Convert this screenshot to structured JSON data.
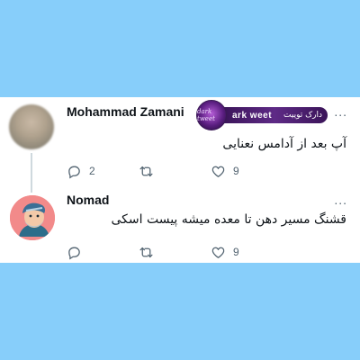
{
  "colors": {
    "page_background": "#87cefa",
    "card_background": "#ffffff",
    "text_primary": "#0f1419",
    "text_secondary": "#536471",
    "thread_line": "#cfd9de",
    "avatar_2_background": "#f28a8a",
    "watermark_purple": "#5e2a86"
  },
  "watermark": {
    "logo_text": "dark tweet",
    "label_en": "ark  weet",
    "label_fa": "دارک توییت"
  },
  "tweets": [
    {
      "author": "Mohammad Zamani",
      "more": "...",
      "text": "آپ بعد از آدامس نعنایی",
      "avatar_icon": "blurred-profile-photo",
      "actions": {
        "reply_icon": "reply-icon",
        "reply_count": "2",
        "retweet_icon": "retweet-icon",
        "retweet_count": "",
        "like_icon": "heart-icon",
        "like_count": "9"
      }
    },
    {
      "author": "Nomad",
      "more": "...",
      "text": "قشنگ مسیر دهن تا معده میشه پیست اسکی",
      "avatar_icon": "cartoon-character-avatar",
      "actions": {
        "reply_icon": "reply-icon",
        "reply_count": "",
        "retweet_icon": "retweet-icon",
        "retweet_count": "",
        "like_icon": "heart-icon",
        "like_count": "9"
      }
    }
  ]
}
